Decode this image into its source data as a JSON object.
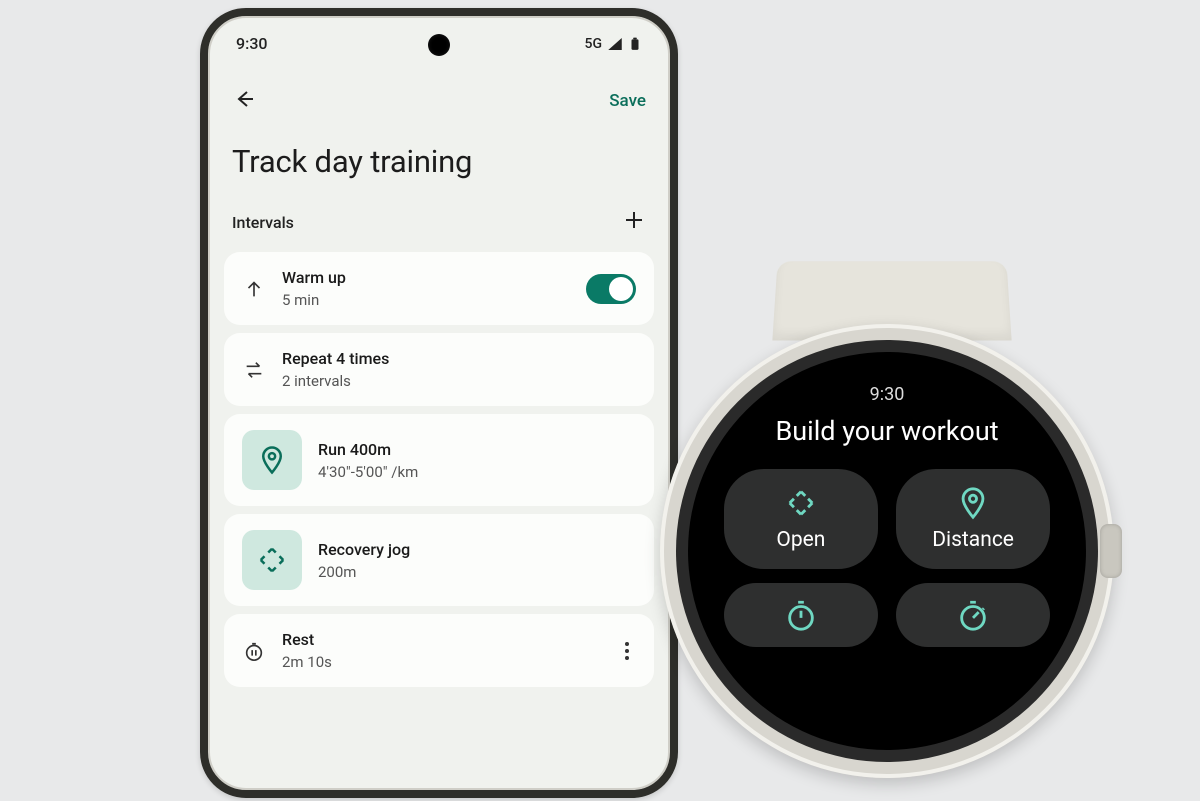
{
  "phone": {
    "status": {
      "time": "9:30",
      "network": "5G"
    },
    "appbar": {
      "save_label": "Save"
    },
    "title": "Track day training",
    "section_label": "Intervals",
    "items": {
      "warmup": {
        "title": "Warm up",
        "sub": "5 min"
      },
      "repeat": {
        "title": "Repeat 4 times",
        "sub": "2 intervals"
      },
      "run": {
        "title": "Run 400m",
        "sub": "4'30\"-5'00\" /km"
      },
      "jog": {
        "title": "Recovery jog",
        "sub": "200m"
      },
      "rest": {
        "title": "Rest",
        "sub": "2m 10s"
      }
    }
  },
  "watch": {
    "time": "9:30",
    "title": "Build your workout",
    "buttons": {
      "open": "Open",
      "distance": "Distance"
    }
  },
  "colors": {
    "accent": "#0a7a66",
    "mint": "#cfe8df",
    "teal_icon": "#6fd8c2"
  }
}
